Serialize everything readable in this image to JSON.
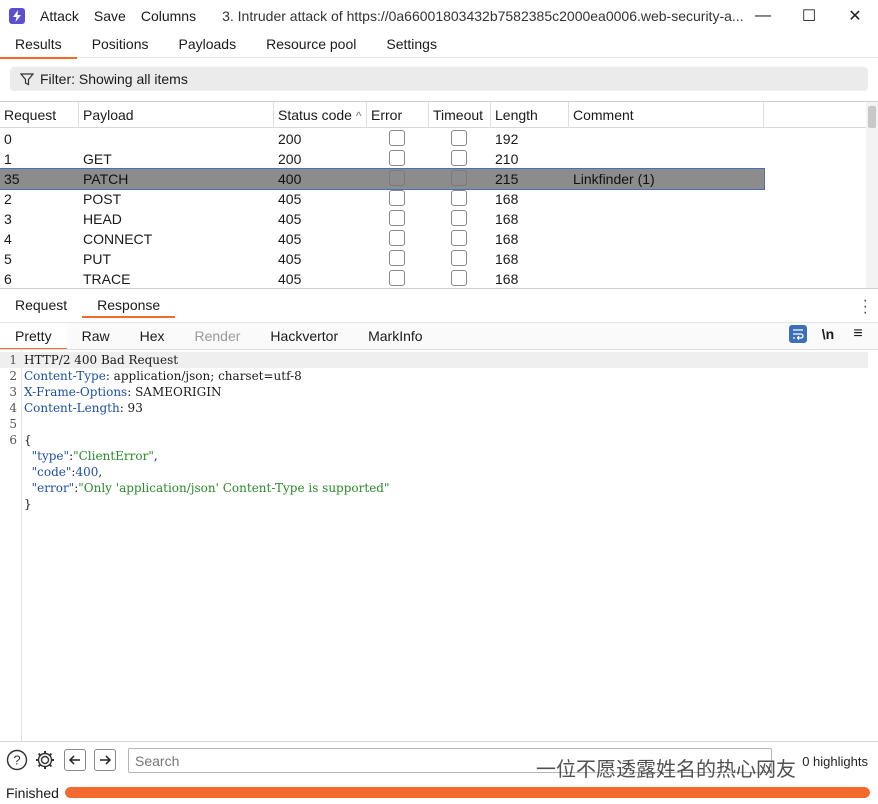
{
  "titlebar": {
    "menu": [
      "Attack",
      "Save",
      "Columns"
    ],
    "window_title": "3. Intruder attack of https://0a66001803432b7582385c2000ea0006.web-security-a...",
    "minimize": "—",
    "maximize": "☐",
    "close": "✕"
  },
  "tabs": [
    "Results",
    "Positions",
    "Payloads",
    "Resource pool",
    "Settings"
  ],
  "filter": {
    "label": "Filter: Showing all items"
  },
  "table": {
    "columns": [
      "Request",
      "Payload",
      "Status code",
      "Error",
      "Timeout",
      "Length",
      "Comment"
    ],
    "sort_indicator": "^",
    "rows": [
      {
        "request": "0",
        "payload": "",
        "status": "200",
        "length": "192",
        "comment": ""
      },
      {
        "request": "1",
        "payload": "GET",
        "status": "200",
        "length": "210",
        "comment": ""
      },
      {
        "request": "35",
        "payload": "PATCH",
        "status": "400",
        "length": "215",
        "comment": "Linkfinder (1)"
      },
      {
        "request": "2",
        "payload": "POST",
        "status": "405",
        "length": "168",
        "comment": ""
      },
      {
        "request": "3",
        "payload": "HEAD",
        "status": "405",
        "length": "168",
        "comment": ""
      },
      {
        "request": "4",
        "payload": "CONNECT",
        "status": "405",
        "length": "168",
        "comment": ""
      },
      {
        "request": "5",
        "payload": "PUT",
        "status": "405",
        "length": "168",
        "comment": ""
      },
      {
        "request": "6",
        "payload": "TRACE",
        "status": "405",
        "length": "168",
        "comment": ""
      }
    ]
  },
  "rr_tabs": [
    "Request",
    "Response"
  ],
  "sub_tabs": [
    "Pretty",
    "Raw",
    "Hex",
    "Render",
    "Hackvertor",
    "MarkInfo"
  ],
  "editor_tools": {
    "newline": "\\n",
    "menu": "≡"
  },
  "response_lines": [
    {
      "num": "1",
      "parts": [
        {
          "t": "HTTP/2 400 Bad Request",
          "c": ""
        }
      ]
    },
    {
      "num": "2",
      "parts": [
        {
          "t": "Content-Type",
          "c": "k"
        },
        {
          "t": ": application/json; charset=utf-8",
          "c": ""
        }
      ]
    },
    {
      "num": "3",
      "parts": [
        {
          "t": "X-Frame-Options",
          "c": "k"
        },
        {
          "t": ": SAMEORIGIN",
          "c": ""
        }
      ]
    },
    {
      "num": "4",
      "parts": [
        {
          "t": "Content-Length",
          "c": "k"
        },
        {
          "t": ": 93",
          "c": ""
        }
      ]
    },
    {
      "num": "5",
      "parts": []
    },
    {
      "num": "6",
      "parts": [
        {
          "t": "{",
          "c": ""
        }
      ]
    },
    {
      "num": "",
      "parts": [
        {
          "t": "  \"type\"",
          "c": "k"
        },
        {
          "t": ":",
          "c": ""
        },
        {
          "t": "\"ClientError\"",
          "c": "s"
        },
        {
          "t": ",",
          "c": ""
        }
      ]
    },
    {
      "num": "",
      "parts": [
        {
          "t": "  \"code\"",
          "c": "k"
        },
        {
          "t": ":",
          "c": ""
        },
        {
          "t": "400",
          "c": "n"
        },
        {
          "t": ",",
          "c": ""
        }
      ]
    },
    {
      "num": "",
      "parts": [
        {
          "t": "  \"error\"",
          "c": "k"
        },
        {
          "t": ":",
          "c": ""
        },
        {
          "t": "\"Only 'application/json' Content-Type is supported\"",
          "c": "s"
        }
      ]
    },
    {
      "num": "",
      "parts": [
        {
          "t": "}",
          "c": ""
        }
      ]
    }
  ],
  "bottombar": {
    "search_placeholder": "Search",
    "highlights": "0 highlights",
    "watermark": "一位不愿透露姓名的热心网友"
  },
  "status": {
    "text": "Finished",
    "progress": 1.0
  },
  "colors": {
    "accent": "#f26b2c",
    "selected_row": "#8c8c8c",
    "key_blue": "#1c4fa3",
    "string_green": "#2a8a2a"
  }
}
